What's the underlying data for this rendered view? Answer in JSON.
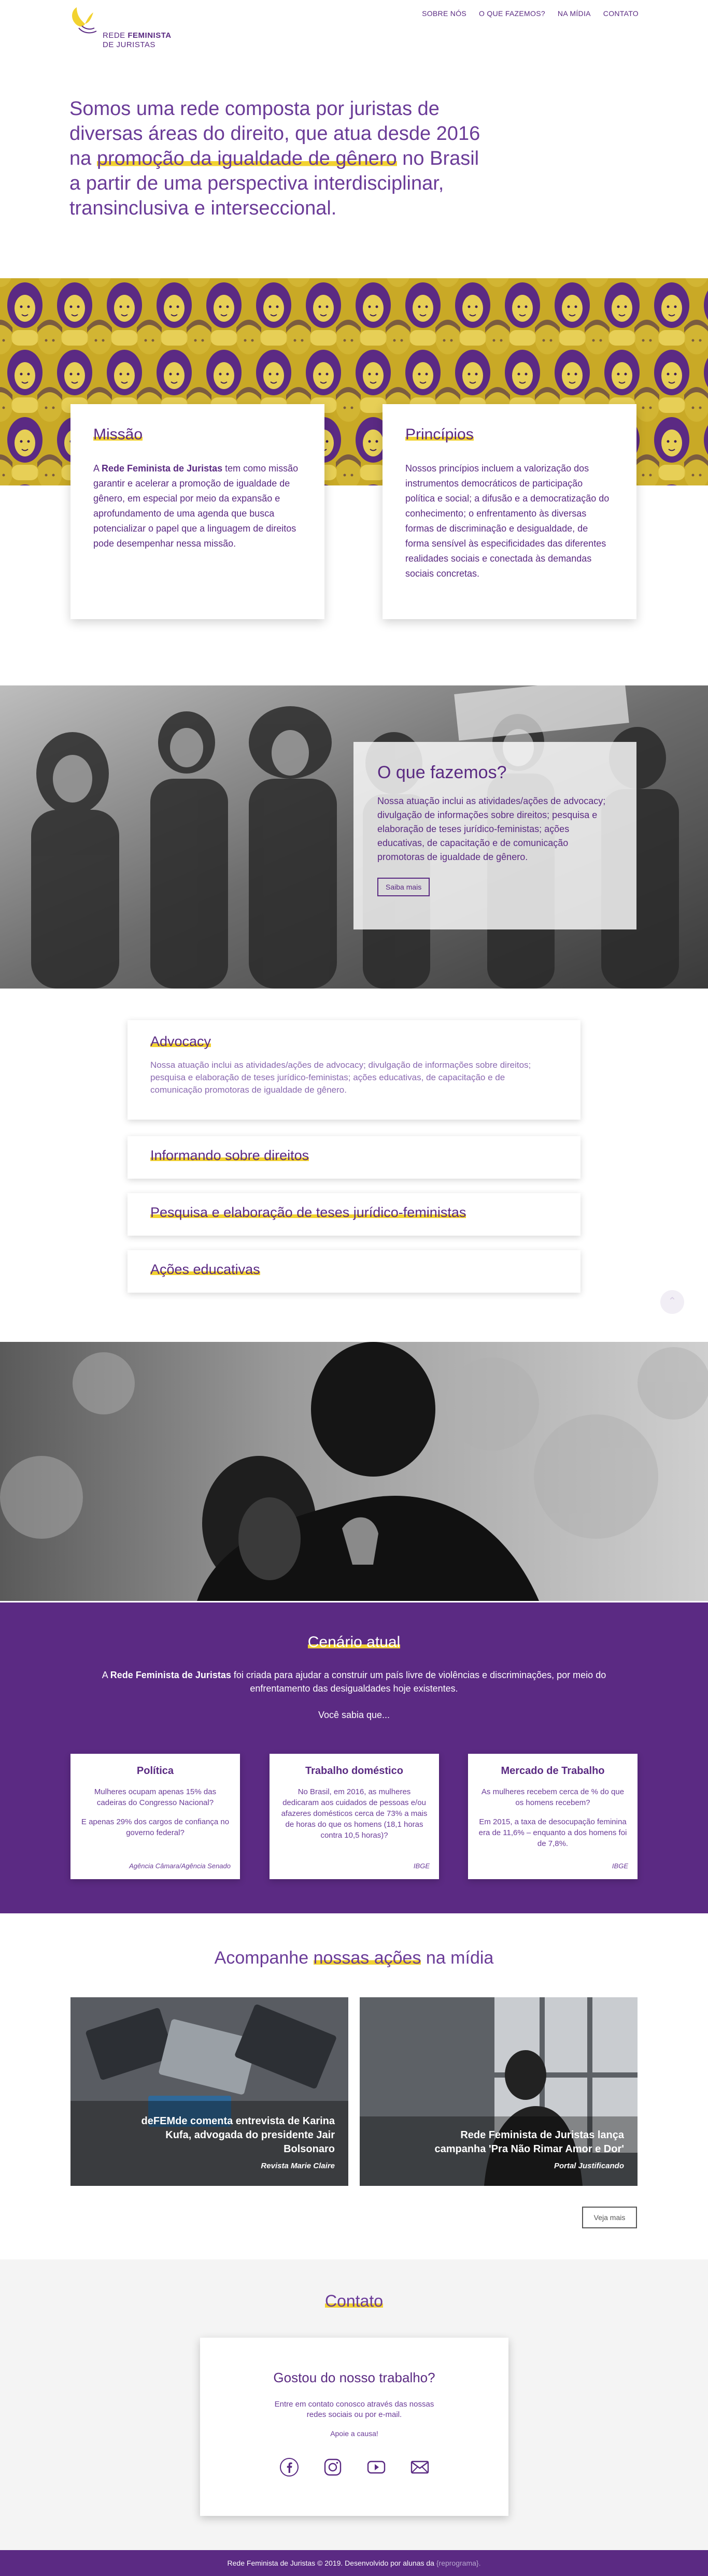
{
  "brand": {
    "line1": "REDE",
    "line1_bold": "FEMINISTA",
    "line2": "DE JURISTAS"
  },
  "nav": {
    "items": [
      {
        "label": "SOBRE NÓS"
      },
      {
        "label": "O QUE FAZEMOS?"
      },
      {
        "label": "NA MÍDIA"
      },
      {
        "label": "CONTATO"
      }
    ]
  },
  "intro": {
    "part1": "Somos uma rede composta por juristas de diversas áreas do direito, que atua desde 2016 na ",
    "highlight": "promoção da igualdade de gênero",
    "part2": " no Brasil a partir de uma perspectiva interdisciplinar, transinclusiva e interseccional."
  },
  "missao": {
    "title": "Missão",
    "text_pre": "A ",
    "text_bold": "Rede Feminista de Juristas",
    "text_post": " tem como missão garantir e acelerar a promoção de igualdade de gênero, em especial por meio da expansão e aprofundamento de uma agenda que busca potencializar o papel que a linguagem de direitos pode desempenhar nessa missão."
  },
  "principios": {
    "title": "Princípios",
    "text": "Nossos princípios incluem a valorização dos instrumentos democráticos de participação política e social; a difusão e a democratização do conhecimento; o enfrentamento às diversas formas de discriminação e desigualdade, de forma sensível às especificidades das diferentes realidades sociais e conectada às demandas sociais concretas."
  },
  "what_we_do": {
    "title": "O que fazemos?",
    "text": "Nossa atuação inclui as atividades/ações de advocacy; divulgação de informações sobre direitos; pesquisa e elaboração de teses jurídico-feministas; ações educativas, de capacitação e de comunicação promotoras de igualdade de gênero.",
    "button": "Saiba mais"
  },
  "accordion": [
    {
      "title": "Advocacy",
      "text": "Nossa atuação inclui as atividades/ações de advocacy; divulgação de informações sobre direitos; pesquisa e elaboração de teses jurídico-feministas; ações educativas, de capacitação e de comunicação promotoras de igualdade de gênero."
    },
    {
      "title": "Informando sobre direitos"
    },
    {
      "title": "Pesquisa e elaboração de teses jurídico-feministas"
    },
    {
      "title": "Ações educativas"
    }
  ],
  "cenario": {
    "title": "Cenário atual",
    "intro_pre": "A ",
    "intro_bold": "Rede Feminista de Juristas",
    "intro_post": " foi criada para ajudar a construir um país livre de violências e discriminações, por meio do enfrentamento das desigualdades hoje existentes.",
    "sabia": "Você sabia que...",
    "cards": [
      {
        "title": "Política",
        "text1": "Mulheres ocupam apenas 15% das cadeiras do Congresso Nacional?",
        "text2": "E apenas 29% dos cargos de confiança no governo federal?",
        "source": "Agência Câmara/Agência Senado"
      },
      {
        "title": "Trabalho doméstico",
        "text1": "No Brasil, em 2016, as mulheres dedicaram aos cuidados de pessoas e/ou afazeres domésticos cerca de 73% a mais de horas do que os homens (18,1 horas contra 10,5 horas)?",
        "text2": "",
        "source": "IBGE"
      },
      {
        "title": "Mercado de Trabalho",
        "text1": "As mulheres recebem cerca de % do que os homens recebem?",
        "text2": "Em 2015, a taxa de desocupação feminina era de 11,6% – enquanto a dos homens foi de 7,8%.",
        "source": "IBGE"
      }
    ]
  },
  "media": {
    "title_pre": "Acompanhe ",
    "title_hl": "nossas ações",
    "title_post": " na mídia",
    "items": [
      {
        "headline": "deFEMde comenta entrevista de Karina Kufa, advogada do presidente Jair Bolsonaro",
        "source": "Revista Marie Claire"
      },
      {
        "headline": "Rede Feminista de Juristas lança campanha 'Pra Não Rimar Amor e Dor'",
        "source": "Portal Justificando"
      }
    ],
    "more_button": "Veja mais"
  },
  "contato": {
    "title": "Contato",
    "card_title": "Gostou do nosso trabalho?",
    "text": "Entre em contato conosco através das nossas redes sociais ou por e-mail.",
    "apoie": "Apoie a causa!",
    "icons": [
      "facebook-icon",
      "instagram-icon",
      "youtube-icon",
      "email-icon"
    ]
  },
  "footer": {
    "text": "Rede Feminista de Juristas © 2019. Desenvolvido por alunas da ",
    "credit": "{reprograma}."
  },
  "colors": {
    "purple": "#5a2a82",
    "yellow": "#f2d230"
  }
}
